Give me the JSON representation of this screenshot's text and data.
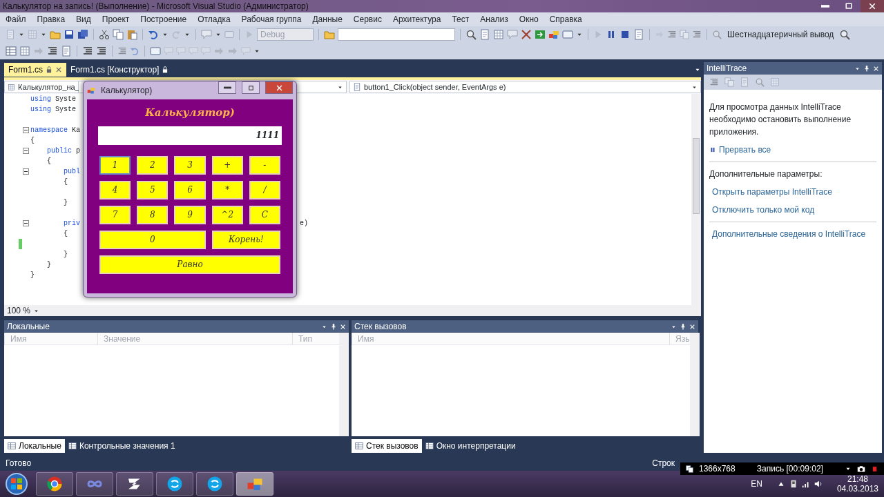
{
  "window": {
    "title": "Калькулятор на запись! (Выполнение) - Microsoft Visual Studio (Администратор)"
  },
  "menu": [
    "Файл",
    "Правка",
    "Вид",
    "Проект",
    "Построение",
    "Отладка",
    "Рабочая группа",
    "Данные",
    "Сервис",
    "Архитектура",
    "Тест",
    "Анализ",
    "Окно",
    "Справка"
  ],
  "toolbar": {
    "config": {
      "value": "Debug",
      "disabled": true
    },
    "hex_output": "Шестнадцатеричный вывод"
  },
  "editor": {
    "tabs": [
      {
        "label": "Form1.cs",
        "selected": true
      },
      {
        "label": "Form1.cs [Конструктор]",
        "selected": false
      }
    ],
    "type_dropdown": "Калькулятор_на_",
    "member_dropdown": "button1_Click(object sender, EventArgs e)",
    "lines": [
      {
        "keyword": "using",
        "text": " Syste",
        "fold": false,
        "changed": false
      },
      {
        "keyword": "using",
        "text": " Syste",
        "fold": false,
        "changed": false
      },
      {
        "fold": false,
        "changed": false
      },
      {
        "keyword": "namespace",
        "text": " Ka",
        "fold": true,
        "changed": false
      },
      {
        "text": "{",
        "fold": false,
        "changed": false
      },
      {
        "keyword": "    public",
        "text": " p",
        "fold": true,
        "changed": false
      },
      {
        "text": "    {",
        "fold": false,
        "changed": false
      },
      {
        "keyword": "        publ",
        "fold": true,
        "changed": false
      },
      {
        "text": "        {",
        "fold": false,
        "changed": false
      },
      {
        "fold": false,
        "changed": false
      },
      {
        "text": "        }",
        "fold": false,
        "changed": false
      },
      {
        "fold": false,
        "changed": false
      },
      {
        "keyword": "        priv",
        "tail": "e)",
        "fold": true,
        "changed": false
      },
      {
        "text": "        {",
        "fold": false,
        "changed": false
      },
      {
        "fold": false,
        "changed": true
      },
      {
        "text": "        }",
        "fold": false,
        "changed": false
      },
      {
        "text": "    }",
        "fold": false,
        "changed": false
      },
      {
        "text": "}",
        "fold": false,
        "changed": false
      }
    ],
    "zoom": "100 %"
  },
  "calculator": {
    "title": "Калькулятор)",
    "heading": "Калькулятор)",
    "display": "1111",
    "button_rows": [
      [
        {
          "label": "1",
          "hovered": true
        },
        {
          "label": "2",
          "hovered": false
        },
        {
          "label": "3",
          "hovered": false
        },
        {
          "label": "+",
          "hovered": false
        },
        {
          "label": "-",
          "hovered": false
        }
      ],
      [
        {
          "label": "4",
          "hovered": false
        },
        {
          "label": "5",
          "hovered": false
        },
        {
          "label": "6",
          "hovered": false
        },
        {
          "label": "*",
          "hovered": false
        },
        {
          "label": "/",
          "hovered": false
        }
      ],
      [
        {
          "label": "7",
          "hovered": false
        },
        {
          "label": "8",
          "hovered": false
        },
        {
          "label": "9",
          "hovered": false
        },
        {
          "label": "^2",
          "hovered": false
        },
        {
          "label": "C",
          "hovered": false
        }
      ],
      [
        {
          "label": "0",
          "hovered": false
        },
        {
          "label": "Корень!",
          "hovered": false
        }
      ],
      [
        {
          "label": "Равно",
          "hovered": false
        }
      ]
    ]
  },
  "intellitrace": {
    "title": "IntelliTrace",
    "message": "Для просмотра данных IntelliTrace необходимо остановить выполнение приложения.",
    "break_all": "Прервать все",
    "options_heading": "Дополнительные параметры:",
    "links": [
      "Открыть параметры IntelliTrace",
      "Отключить только мой код"
    ],
    "more_link": "Дополнительные сведения о IntelliTrace"
  },
  "panels": [
    {
      "title": "Локальные",
      "columns": [
        "Имя",
        "Значение",
        "Тип"
      ],
      "tabs": [
        {
          "label": "Локальные",
          "selected": true
        },
        {
          "label": "Контрольные значения 1",
          "selected": false
        }
      ]
    },
    {
      "title": "Стек вызовов",
      "columns": [
        "Имя",
        "Язы"
      ],
      "tabs": [
        {
          "label": "Стек вызовов",
          "selected": true
        },
        {
          "label": "Окно интерпретации",
          "selected": false
        }
      ]
    }
  ],
  "status_bar": {
    "left": "Готово",
    "right": "Строк"
  },
  "recorder": {
    "resolution": "1366x768",
    "label": "Запись [00:09:02]"
  },
  "taskbar": {
    "apps": [
      {
        "kind": "browser",
        "selected": false
      },
      {
        "kind": "infinity",
        "selected": false
      },
      {
        "kind": "logo",
        "selected": false
      },
      {
        "kind": "chat",
        "selected": false
      },
      {
        "kind": "chat",
        "selected": false
      },
      {
        "kind": "tiles",
        "selected": true
      }
    ],
    "language": "EN",
    "time": "21:48",
    "date": "04.03.2013"
  }
}
